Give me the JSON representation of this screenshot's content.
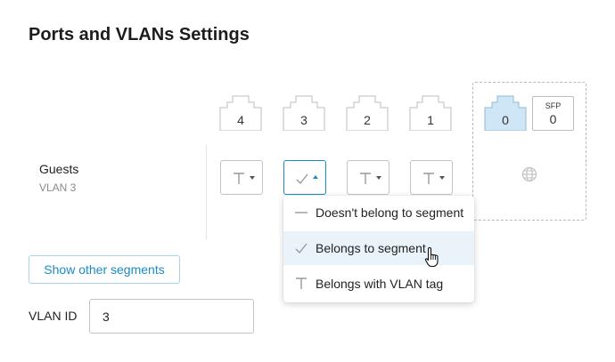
{
  "page": {
    "title": "Ports and VLANs Settings"
  },
  "ports": [
    {
      "number": "4",
      "active": false
    },
    {
      "number": "3",
      "active": false
    },
    {
      "number": "2",
      "active": false
    },
    {
      "number": "1",
      "active": false
    }
  ],
  "wan_ports": [
    {
      "number": "0",
      "active": true
    },
    {
      "label": "SFP",
      "number": "0",
      "active": false
    }
  ],
  "segment": {
    "name": "Guests",
    "vlan": "VLAN 3",
    "port_modes": [
      "tag",
      "member",
      "tag",
      "tag"
    ],
    "open_selector_index": 1
  },
  "dropdown": {
    "options": [
      {
        "icon": "dash-icon",
        "label": "Doesn't belong to segment"
      },
      {
        "icon": "check-icon",
        "label": "Belongs to segment",
        "hovered": true
      },
      {
        "icon": "t-tag-icon",
        "label": "Belongs with VLAN tag"
      }
    ]
  },
  "buttons": {
    "show_other": "Show other segments"
  },
  "vlan_id": {
    "label": "VLAN ID",
    "value": "3"
  },
  "colors": {
    "accent": "#1a8cc4",
    "active_port": "#cfe6f6",
    "hover": "#eaf3fa"
  }
}
